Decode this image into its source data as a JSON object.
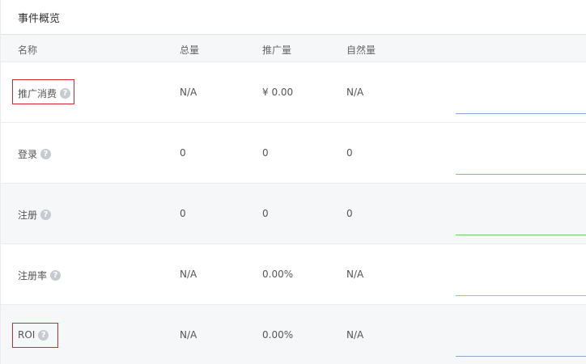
{
  "panel": {
    "title": "事件概览"
  },
  "columns": {
    "name": "名称",
    "total": "总量",
    "promo": "推广量",
    "natural": "自然量"
  },
  "rows": [
    {
      "name": "推广消费",
      "total": "N/A",
      "promo": "¥ 0.00",
      "natural": "N/A",
      "trend_color": "#8aa6d6",
      "highlighted": true
    },
    {
      "name": "登录",
      "total": "0",
      "promo": "0",
      "natural": "0",
      "trend_color": "#7cc576",
      "highlighted": false
    },
    {
      "name": "注册",
      "total": "0",
      "promo": "0",
      "natural": "0",
      "trend_color": "#7cc576",
      "highlighted": false
    },
    {
      "name": "注册率",
      "total": "N/A",
      "promo": "0.00%",
      "natural": "N/A",
      "trend_color": "#e0b63f",
      "highlighted": false
    },
    {
      "name": "ROI",
      "total": "N/A",
      "promo": "0.00%",
      "natural": "N/A",
      "trend_color": "#8aa6d6",
      "highlighted": true
    }
  ],
  "icons": {
    "help": "help-circle-icon",
    "help_glyph": "?"
  }
}
